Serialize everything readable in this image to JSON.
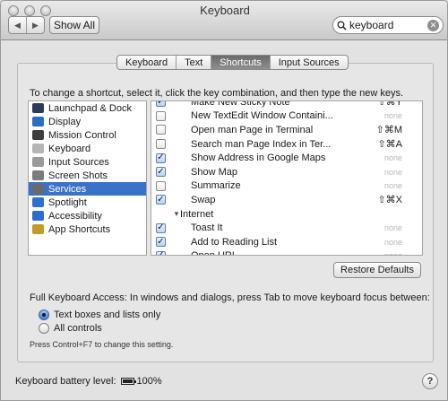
{
  "window": {
    "title": "Keyboard"
  },
  "toolbar": {
    "back_icon": "chevron-left-icon",
    "forward_icon": "chevron-right-icon",
    "show_all_label": "Show All"
  },
  "search": {
    "value": "keyboard",
    "icon": "search-icon"
  },
  "tabs": [
    {
      "label": "Keyboard",
      "selected": false
    },
    {
      "label": "Text",
      "selected": false
    },
    {
      "label": "Shortcuts",
      "selected": true
    },
    {
      "label": "Input Sources",
      "selected": false
    }
  ],
  "instruction": "To change a shortcut, select it, click the key combination, and then type the new keys.",
  "categories": [
    {
      "label": "Launchpad & Dock",
      "icon": "launchpad-icon",
      "color": "#2c3b5c"
    },
    {
      "label": "Display",
      "icon": "display-icon",
      "color": "#2b6cc4"
    },
    {
      "label": "Mission Control",
      "icon": "mission-control-icon",
      "color": "#3d3d3d"
    },
    {
      "label": "Keyboard",
      "icon": "keyboard-icon",
      "color": "#b5b5b5"
    },
    {
      "label": "Input Sources",
      "icon": "input-sources-icon",
      "color": "#9a9a9a"
    },
    {
      "label": "Screen Shots",
      "icon": "screenshot-icon",
      "color": "#7b7b7b"
    },
    {
      "label": "Services",
      "icon": "services-icon",
      "color": "#6a6a6a",
      "selected": true
    },
    {
      "label": "Spotlight",
      "icon": "spotlight-icon",
      "color": "#2f6fd0"
    },
    {
      "label": "Accessibility",
      "icon": "accessibility-icon",
      "color": "#2e6bcf"
    },
    {
      "label": "App Shortcuts",
      "icon": "app-shortcuts-icon",
      "color": "#c49a2a"
    }
  ],
  "shortcuts": [
    {
      "label": "Make New Sticky Note",
      "checked": true,
      "key": "⇧⌘Y",
      "none": false
    },
    {
      "label": "New TextEdit Window Containi...",
      "checked": false,
      "key": "none",
      "none": true
    },
    {
      "label": "Open man Page in Terminal",
      "checked": false,
      "key": "⇧⌘M",
      "none": false
    },
    {
      "label": "Search man Page Index in Ter...",
      "checked": false,
      "key": "⇧⌘A",
      "none": false
    },
    {
      "label": "Show Address in Google Maps",
      "checked": true,
      "key": "none",
      "none": true
    },
    {
      "label": "Show Map",
      "checked": true,
      "key": "none",
      "none": true
    },
    {
      "label": "Summarize",
      "checked": false,
      "key": "none",
      "none": true
    },
    {
      "label": "Swap",
      "checked": true,
      "key": "⇧⌘X",
      "none": false
    },
    {
      "label": "Internet",
      "group": true
    },
    {
      "label": "Toast It",
      "checked": true,
      "key": "none",
      "none": true
    },
    {
      "label": "Add to Reading List",
      "checked": true,
      "key": "none",
      "none": true
    },
    {
      "label": "Open URL",
      "checked": true,
      "key": "none",
      "none": true
    }
  ],
  "restore_defaults_label": "Restore Defaults",
  "full_keyboard_access": {
    "label": "Full Keyboard Access: In windows and dialogs, press Tab to move keyboard focus between:",
    "options": [
      {
        "label": "Text boxes and lists only",
        "selected": true
      },
      {
        "label": "All controls",
        "selected": false
      }
    ],
    "hint": "Press Control+F7 to change this setting."
  },
  "battery": {
    "label": "Keyboard battery level:",
    "level": "100%"
  },
  "help_label": "?"
}
